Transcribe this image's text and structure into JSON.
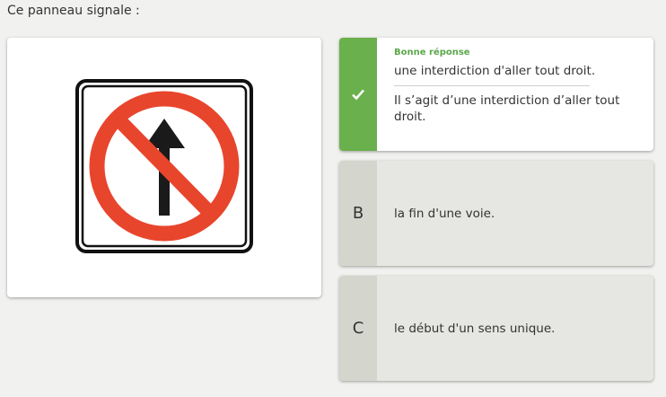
{
  "question": "Ce panneau signale :",
  "sign_image": {
    "icon": "no-straight-ahead-sign",
    "colors": {
      "circle": "#e8452d",
      "arrow": "#1a1a1a",
      "frame": "#111111",
      "background": "#ffffff"
    }
  },
  "answers": [
    {
      "marker_icon": "check-icon",
      "correct_label": "Bonne réponse",
      "text": "une interdiction d'aller tout droit.",
      "explanation": "Il s’agit d’une interdiction d’aller tout droit.",
      "state": "correct",
      "color": "#6ab04c"
    },
    {
      "marker": "B",
      "text": "la fin d'une voie."
    },
    {
      "marker": "C",
      "text": "le début d'un sens unique."
    }
  ]
}
